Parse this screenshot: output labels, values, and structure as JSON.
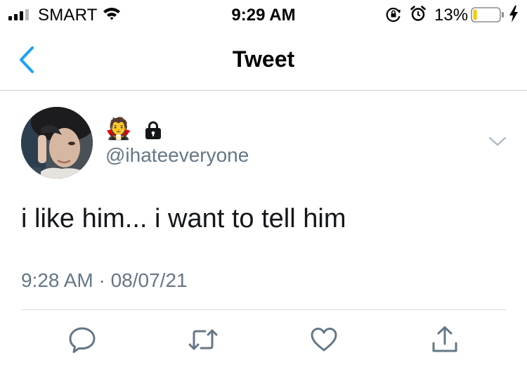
{
  "status_bar": {
    "carrier": "SMART",
    "time": "9:29 AM",
    "battery_percent": "13%",
    "battery_level": 0.13,
    "battery_color": "#f5c90c"
  },
  "nav": {
    "title": "Tweet",
    "back_icon": "chevron-left-icon",
    "accent_color": "#1da1f2"
  },
  "tweet": {
    "name_emoji": "🧛",
    "protected_icon": "lock-icon",
    "handle": "@ihateeveryone",
    "text": "i like him... i want to tell him",
    "timestamp": "9:28 AM · 08/07/21",
    "menu_icon": "chevron-down-icon"
  },
  "actions": [
    {
      "icon": "reply-icon"
    },
    {
      "icon": "retweet-icon"
    },
    {
      "icon": "like-icon"
    },
    {
      "icon": "share-icon"
    }
  ],
  "colors": {
    "secondary_text": "#657786",
    "icon_gray": "#657786",
    "divider": "#d6dadd"
  }
}
